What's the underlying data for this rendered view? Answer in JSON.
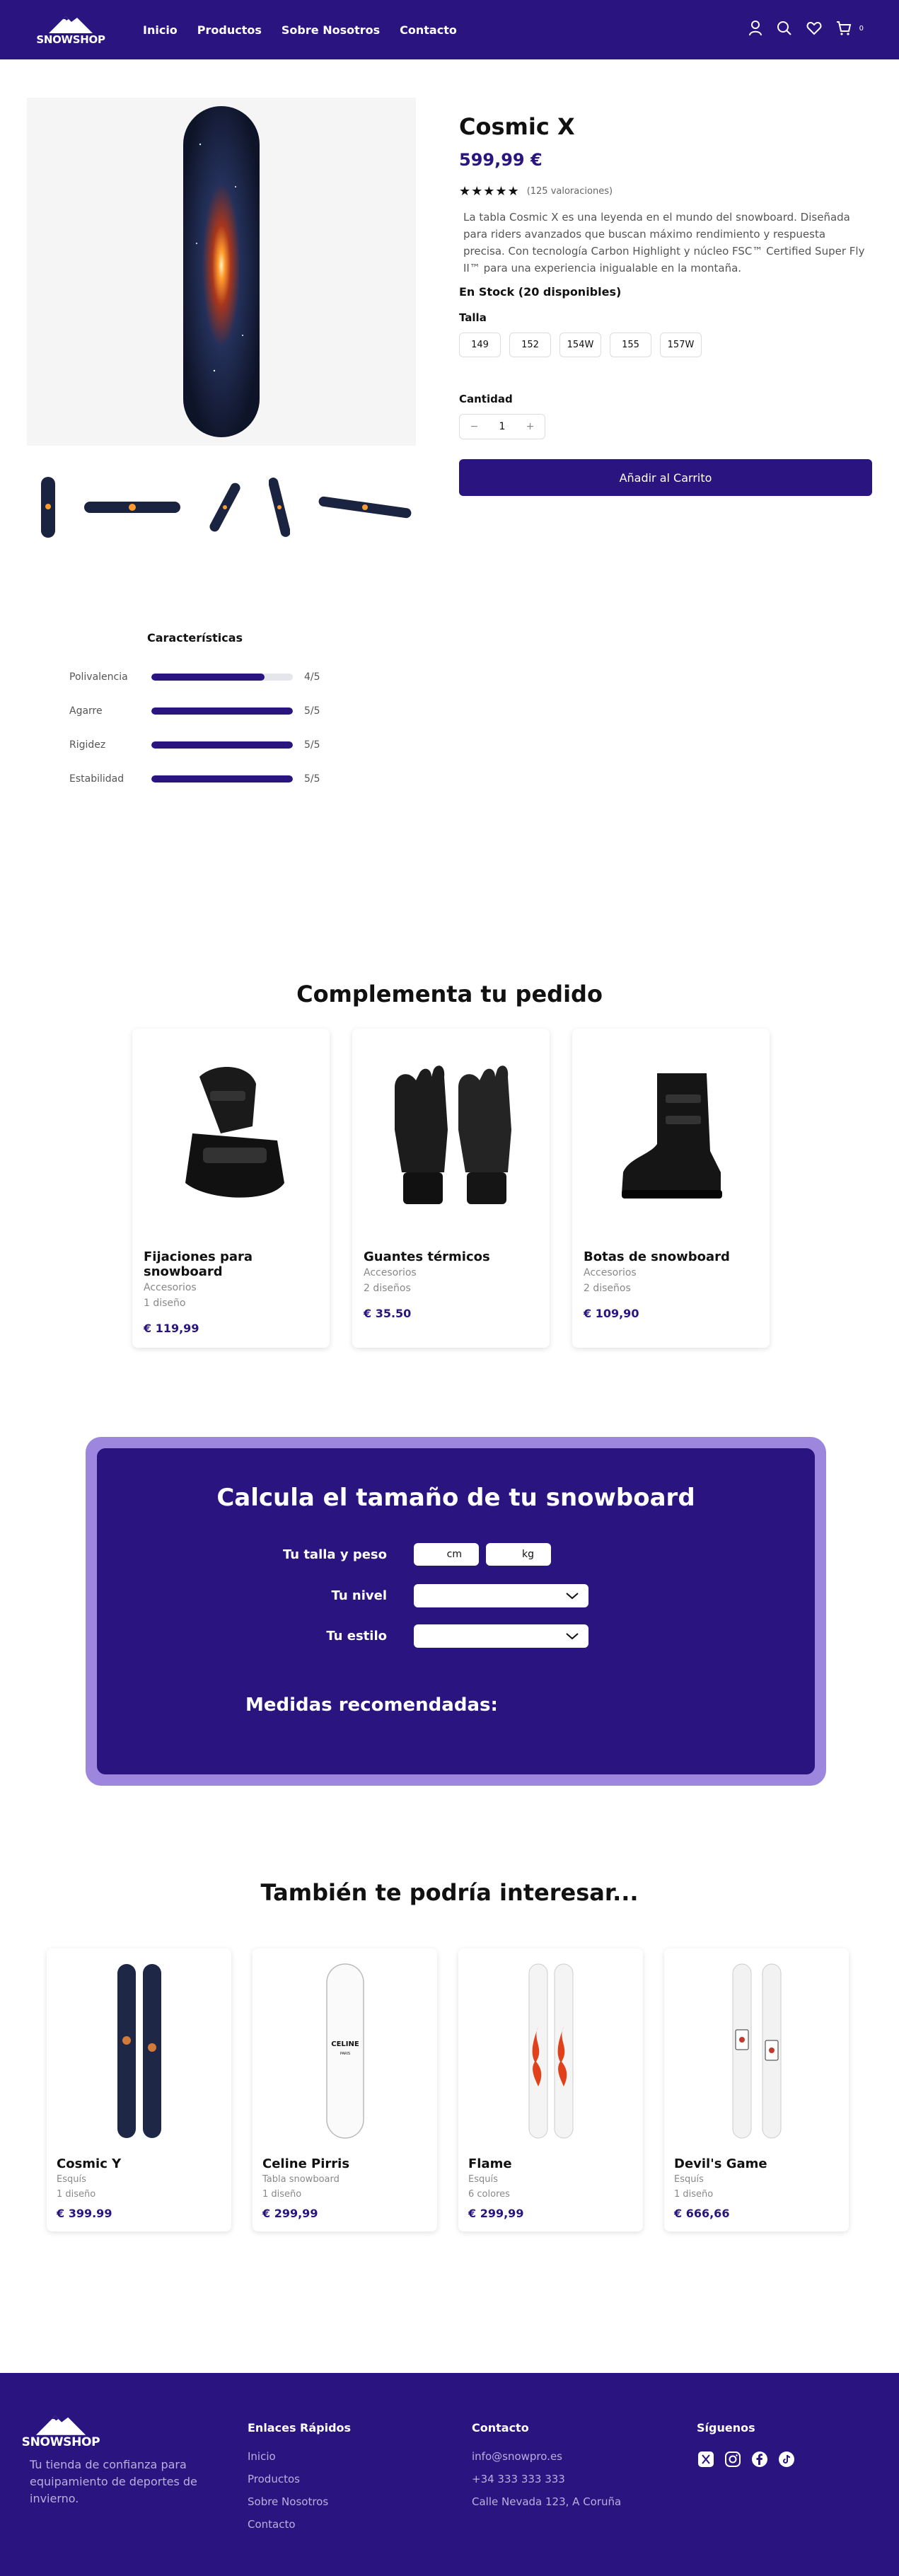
{
  "brand": {
    "name": "SNOWSHOP",
    "color": "#2a1480"
  },
  "nav": {
    "items": [
      "Inicio",
      "Productos",
      "Sobre Nosotros",
      "Contacto"
    ]
  },
  "header": {
    "icons": [
      "user-icon",
      "search-icon",
      "heart-icon",
      "cart-icon"
    ],
    "cart_count": "0"
  },
  "product": {
    "title": "Cosmic X",
    "price": "599,99 €",
    "stars": "★★★★★",
    "rating_text": "(125 valoraciones)",
    "description": "La tabla Cosmic X es una leyenda en el mundo del snowboard. Diseñada para riders avanzados que buscan máximo rendimiento y respuesta precisa. Con tecnología Carbon Highlight y núcleo FSC™ Certified Super Fly II™ para una experiencia inigualable en la montaña.",
    "stock": "En Stock (20 disponibles)",
    "size_label": "Talla",
    "sizes": [
      "149",
      "152",
      "154W",
      "155",
      "157W"
    ],
    "qty_label": "Cantidad",
    "qty_minus": "−",
    "qty_value": "1",
    "qty_plus": "+",
    "add_to_cart": "Añadir al Carrito"
  },
  "characteristics": {
    "title": "Características",
    "items": [
      {
        "name": "Polivalencia",
        "value": 4,
        "max": 5,
        "label": "4/5"
      },
      {
        "name": "Agarre",
        "value": 5,
        "max": 5,
        "label": "5/5"
      },
      {
        "name": "Rigidez",
        "value": 5,
        "max": 5,
        "label": "5/5"
      },
      {
        "name": "Estabilidad",
        "value": 5,
        "max": 5,
        "label": "5/5"
      }
    ]
  },
  "complement": {
    "title": "Complementa tu pedido",
    "items": [
      {
        "name": "Fijaciones para snowboard",
        "category": "Accesorios",
        "meta": "1 diseño",
        "price": "€ 119,99"
      },
      {
        "name": "Guantes térmicos",
        "category": "Accesorios",
        "meta": "2 diseños",
        "price": "€ 35.50"
      },
      {
        "name": "Botas de snowboard",
        "category": "Accesorios",
        "meta": "2 diseños",
        "price": "€ 109,90"
      }
    ]
  },
  "calculator": {
    "title": "Calcula el tamaño de tu snowboard",
    "size_weight_label": "Tu talla y peso",
    "unit_cm": "cm",
    "unit_kg": "kg",
    "level_label": "Tu nivel",
    "style_label": "Tu estilo",
    "result_label": "Medidas recomendadas:"
  },
  "related": {
    "title": "También te podría interesar...",
    "items": [
      {
        "name": "Cosmic Y",
        "category": "Esquís",
        "meta": "1 diseño",
        "price": "€ 399.99"
      },
      {
        "name": "Celine Pirris",
        "category": "Tabla snowboard",
        "meta": "1 diseño",
        "price": "€ 299,99",
        "board_text": "CELINE",
        "board_sub": "PARIS"
      },
      {
        "name": "Flame",
        "category": "Esquís",
        "meta": "6 colores",
        "price": "€ 299,99"
      },
      {
        "name": "Devil's Game",
        "category": "Esquís",
        "meta": "1 diseño",
        "price": "€ 666,66"
      }
    ]
  },
  "footer": {
    "description": "Tu tienda de confianza para equipamiento de deportes de invierno.",
    "quick_links_title": "Enlaces Rápidos",
    "quick_links": [
      "Inicio",
      "Productos",
      "Sobre Nosotros",
      "Contacto"
    ],
    "contact_title": "Contacto",
    "contact": [
      "info@snowpro.es",
      "+34 333 333 333",
      "Calle Nevada 123, A Coruña"
    ],
    "social_title": "Síguenos",
    "socials": [
      "x-icon",
      "instagram-icon",
      "facebook-icon",
      "tiktok-icon"
    ]
  }
}
